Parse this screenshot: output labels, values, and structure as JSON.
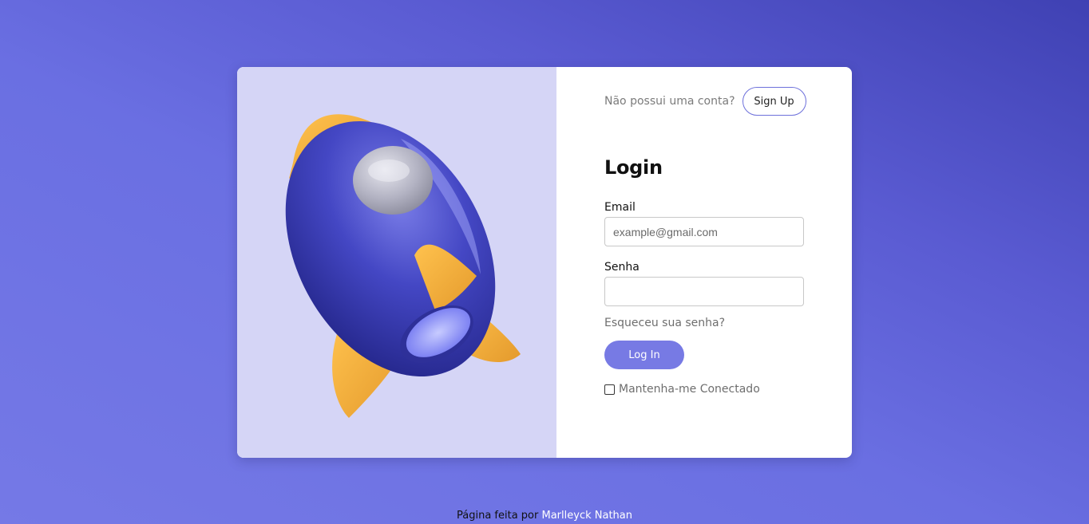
{
  "signup": {
    "prompt": "Não possui uma conta?",
    "button_label": "Sign Up"
  },
  "login": {
    "title": "Login",
    "email_label": "Email",
    "email_placeholder": "example@gmail.com",
    "email_value": "",
    "password_label": "Senha",
    "password_value": "",
    "forgot_link": "Esqueceu sua senha?",
    "submit_label": "Log In",
    "remember_label": "Mantenha-me Conectado",
    "remember_checked": false
  },
  "footer": {
    "prefix": "Página feita por",
    "author": "Marlleyck Nathan"
  },
  "colors": {
    "accent": "#777ae4",
    "illustration_bg": "#d5d5f6",
    "rocket_body": "#3c3eb8",
    "rocket_fin": "#f0b23c"
  },
  "illustration": {
    "icon": "rocket-icon"
  }
}
